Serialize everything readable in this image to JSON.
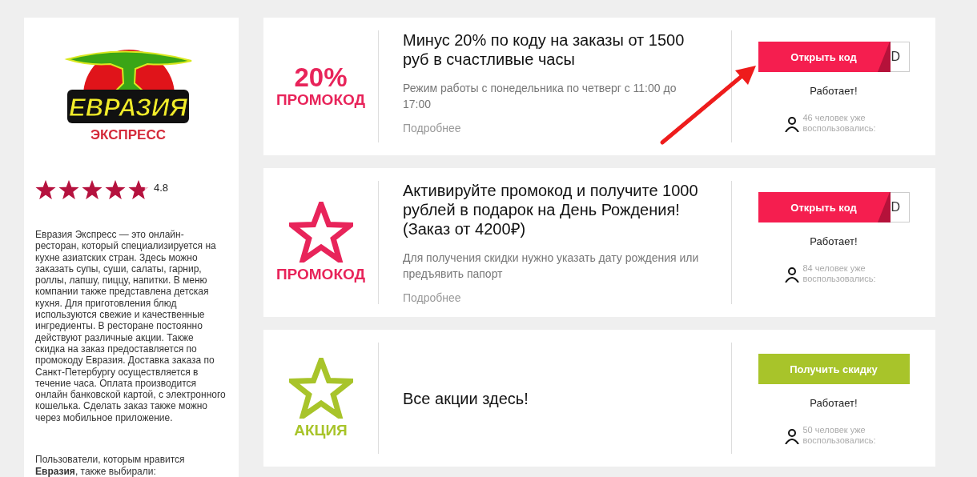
{
  "sidebar": {
    "logo": {
      "title": "ЕВРАЗИЯ",
      "subtitle": "ЭКСПРЕСС"
    },
    "rating": {
      "stars": 4.8,
      "value": "4.8"
    },
    "description": "Евразия Экспресс — это онлайн-ресторан, который специализируется на кухне азиатских стран. Здесь можно заказать супы, суши, салаты, гарнир, роллы, лапшу, пиццу, напитки. В меню компании также представлена детская кухня. Для приготовления блюд используются свежие и качественные ингредиенты. В ресторане постоянно действуют различные акции. Также скидка на заказ предоставляется по промокоду Евразия. Доставка заказа по Санкт-Петербургу осуществляется в течение часа. Оплата производится онлайн банковской картой, с электронного кошелька. Сделать заказ также можно через мобильное приложение.",
    "related": "Пользователи, которым нравится **Евразия**, также выбирали:"
  },
  "offers": [
    {
      "kind": "percent",
      "badge": "20%",
      "label": "ПРОМОКОД",
      "color": "#e8245a",
      "title": "Минус 20% по коду на заказы от 1500 руб в счастливые часы",
      "note": "Режим работы с понедельника по четверг с 11:00 до 17:00",
      "more": "Подробнее",
      "action": {
        "kind": "code",
        "label": "Открыть код",
        "code_peek": "D"
      },
      "status": "Работает!",
      "usage": "46 человек уже воспользовались:"
    },
    {
      "kind": "star",
      "label": "ПРОМОКОД",
      "color": "#e8245a",
      "title": "Активируйте промокод и получите 1000 рублей в подарок на День Рождения! (Заказ от 4200₽)",
      "note": "Для получения скидки нужно указать дату рождения или предъявить папорт",
      "more": "Подробнее",
      "action": {
        "kind": "code",
        "label": "Открыть код",
        "code_peek": "D"
      },
      "status": "Работает!",
      "usage": "84 человек уже воспользовались:"
    },
    {
      "kind": "star",
      "label": "АКЦИЯ",
      "color": "#a8c42a",
      "title": "Все акции здесь!",
      "action": {
        "kind": "deal",
        "label": "Получить скидку"
      },
      "status": "Работает!",
      "usage": "50 человек уже воспользовались:"
    }
  ]
}
